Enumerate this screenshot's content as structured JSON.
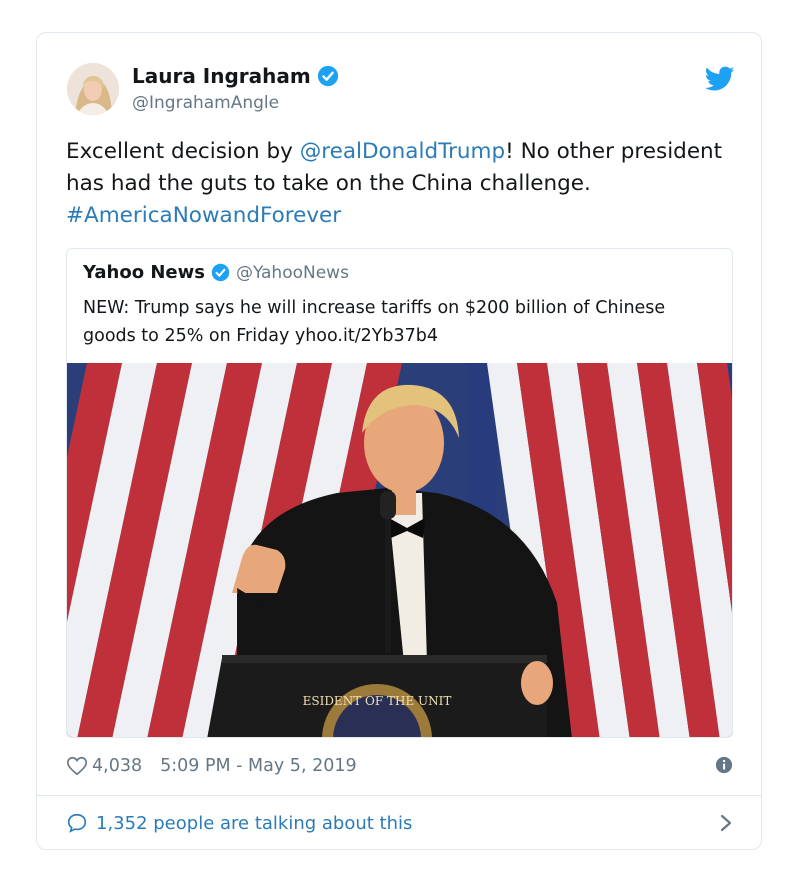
{
  "tweet": {
    "author_name": "Laura Ingraham",
    "author_handle": "@IngrahamAngle",
    "text_before_mention": "Excellent decision by ",
    "mention": "@realDonaldTrump",
    "text_after_mention": "! No other president has had the guts to take on the China challenge. ",
    "hashtag": "#AmericaNowandForever",
    "likes": "4,038",
    "timestamp": "5:09 PM - May 5, 2019",
    "conversation": "1,352 people are talking about this"
  },
  "quoted": {
    "author_name": "Yahoo News",
    "author_handle": "@YahooNews",
    "text": "NEW: Trump says he will increase tariffs on $200 billion of Chinese goods to 25% on Friday yhoo.it/2Yb37b4",
    "photo_seal_text": "ESIDENT OF THE UNIT"
  },
  "icons": {
    "verified": "verified-badge-icon",
    "twitter": "twitter-bird-icon",
    "like": "heart-icon",
    "info": "info-icon",
    "reply": "speech-bubble-icon",
    "chevron": "chevron-right-icon"
  },
  "colors": {
    "link": "#2b7bb9",
    "twitter_blue": "#1da1f2",
    "secondary_text": "#657786",
    "border": "#e1e8ed"
  }
}
